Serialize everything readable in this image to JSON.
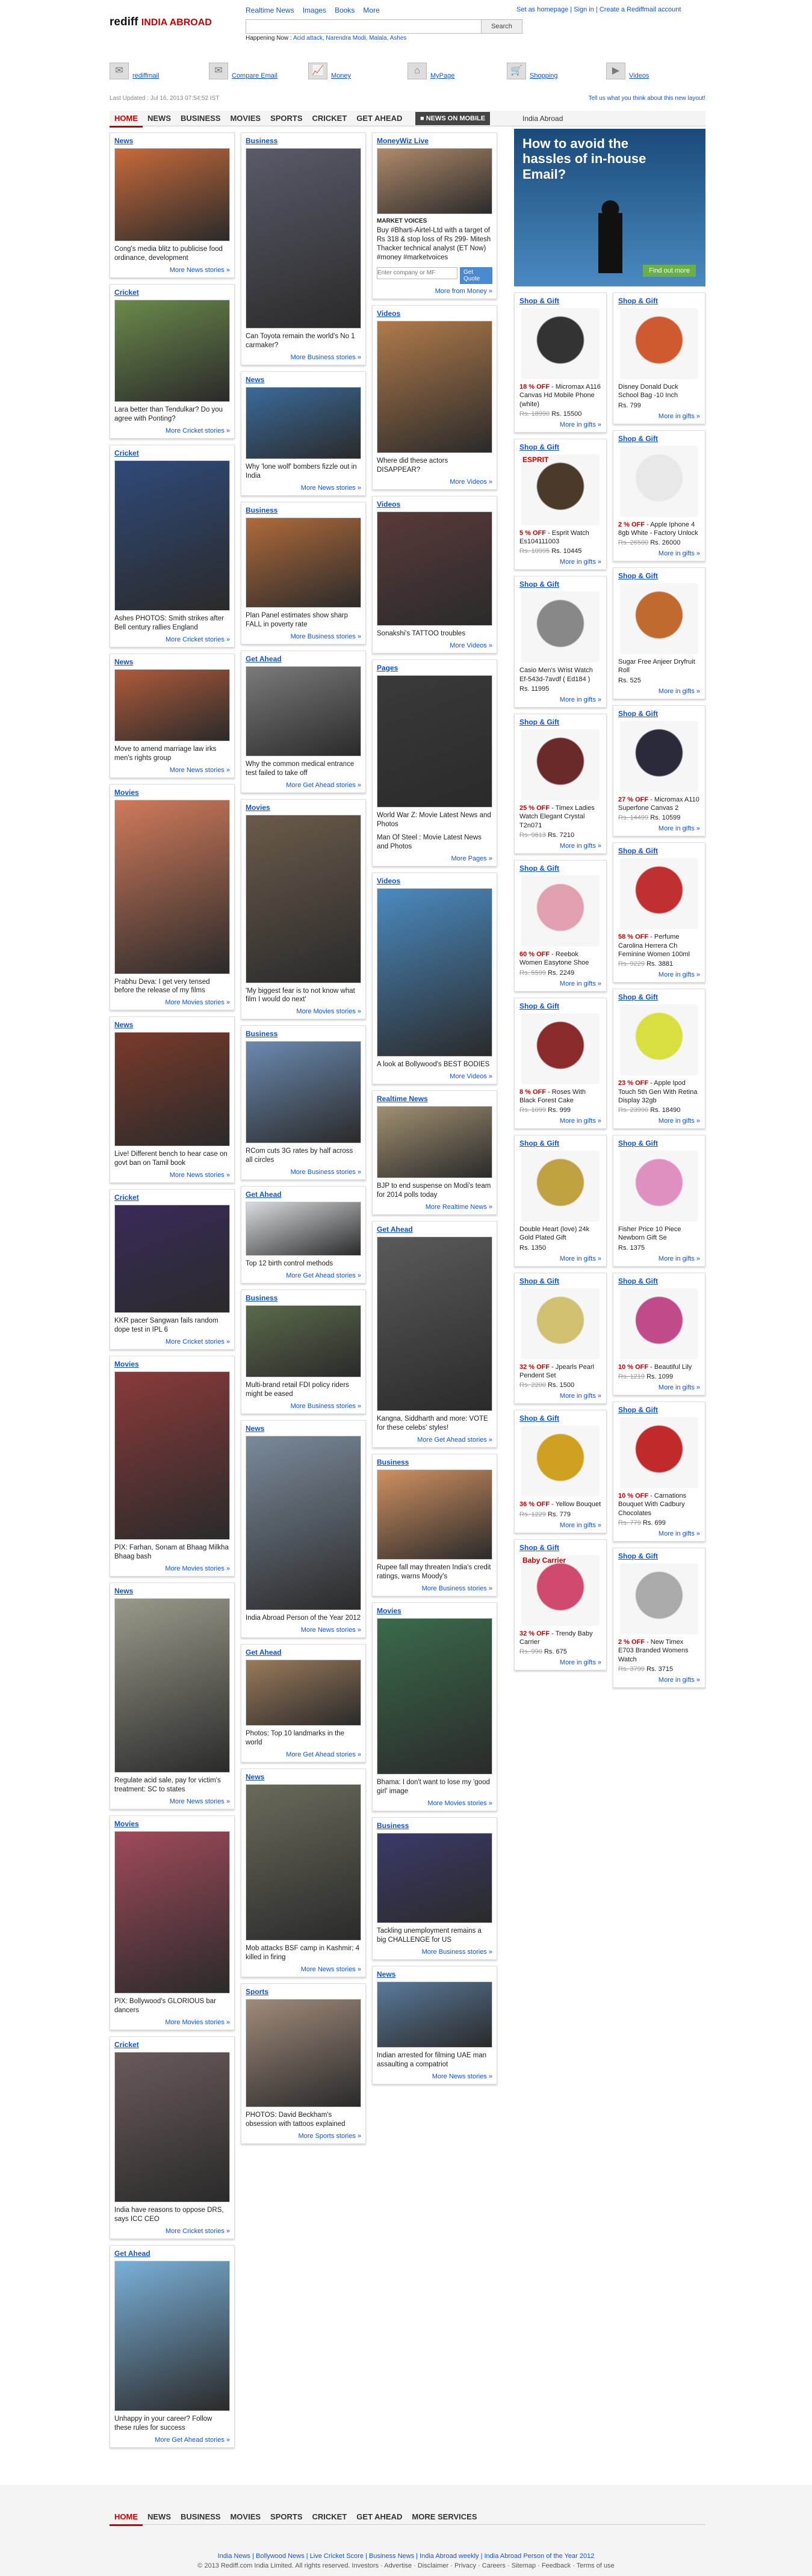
{
  "brand": {
    "rediff": "rediff",
    "section": "INDIA ABROAD"
  },
  "toplinks": [
    "Realtime News",
    "Images",
    "Books",
    "More"
  ],
  "happening": {
    "label": "Happening Now :",
    "links": "Acid attack, Narendra Modi, Malala, Ashes"
  },
  "search": {
    "label": "Search"
  },
  "account": {
    "homepage": "Set as homepage",
    "signin": "Sign in",
    "create": "Create a Rediffmail account"
  },
  "services": [
    "rediffmail",
    "Compare Email",
    "Money",
    "MyPage",
    "Shopping",
    "Videos"
  ],
  "last_updated": "Last Updated : Jul 16, 2013 07:54:52 IST",
  "feedback_link": "Tell us what you think about this new layout!",
  "nav": [
    "HOME",
    "NEWS",
    "BUSINESS",
    "MOVIES",
    "SPORTS",
    "CRICKET",
    "GET AHEAD"
  ],
  "news_mobile": "NEWS ON MOBILE",
  "india_abroad": "India Abroad",
  "ad": {
    "title": "How to avoid the hassles of in-house Email?",
    "cta": "Find out more"
  },
  "col1": [
    {
      "h": "News",
      "cap": "Cong's media blitz to publicise food ordinance, development",
      "more": "More News stories »",
      "c": "#c86a3a",
      "img": 155
    },
    {
      "h": "Cricket",
      "cap": "Lara better than Tendulkar? Do you agree with Ponting?",
      "more": "More Cricket stories »",
      "c": "#6a8a4a",
      "img": 170
    },
    {
      "h": "Cricket",
      "cap": "Ashes PHOTOS: Smith strikes after Bell century rallies England",
      "more": "More Cricket stories »",
      "c": "#2f4a7a",
      "img": 250
    },
    {
      "h": "News",
      "cap": "Move to amend marriage law irks men's rights group",
      "more": "More News stories »",
      "c": "#b05a3a",
      "img": 120
    },
    {
      "h": "Movies",
      "cap": "Prabhu Deva: I get very tensed before the release of my films",
      "more": "More Movies stories »",
      "c": "#d07a5a",
      "img": 290
    },
    {
      "h": "News",
      "cap": "Live! Different bench to hear case on govt ban on Tamil book",
      "more": "More News stories »",
      "c": "#7a3a2a",
      "img": 190
    },
    {
      "h": "Cricket",
      "cap": "KKR pacer Sangwan fails random dope test in IPL 6",
      "more": "More Cricket stories »",
      "c": "#3a2a5a",
      "img": 180
    },
    {
      "h": "Movies",
      "cap": "PIX: Farhan, Sonam at Bhaag Milkha Bhaag bash",
      "more": "More Movies stories »",
      "c": "#8a3a3a",
      "img": 280
    },
    {
      "h": "News",
      "cap": "Regulate acid sale, pay for victim's treatment: SC to states",
      "more": "More News stories »",
      "c": "#9a9a8a",
      "img": 290
    },
    {
      "h": "Movies",
      "cap": "PIX: Bollywood's GLORIOUS bar dancers",
      "more": "More Movies stories »",
      "c": "#a04a5a",
      "img": 270
    },
    {
      "h": "Cricket",
      "cap": "India have reasons to oppose DRS, says ICC CEO",
      "more": "More Cricket stories »",
      "c": "#6a5a5a",
      "img": 250
    },
    {
      "h": "Get Ahead",
      "cap": "Unhappy in your career? Follow these rules for success",
      "more": "More Get Ahead stories »",
      "c": "#7ab0d8",
      "img": 250
    }
  ],
  "col2": [
    {
      "h": "Business",
      "cap": "Can Toyota remain the world's No 1 carmaker?",
      "more": "More Business stories »",
      "c": "#5a5a6a",
      "img": 300
    },
    {
      "h": "News",
      "cap": "Why 'lone wolf' bombers fizzle out in India",
      "more": "More News stories »",
      "c": "#3a6a9a",
      "img": 120
    },
    {
      "h": "Business",
      "cap": "Plan Panel estimates show sharp FALL in poverty rate",
      "more": "More Business stories »",
      "c": "#b06a3a",
      "img": 150
    },
    {
      "h": "Get Ahead",
      "cap": "Why the common medical entrance test failed to take off",
      "more": "More Get Ahead stories »",
      "c": "#7a7a7a",
      "img": 150
    },
    {
      "h": "Movies",
      "cap": "'My biggest fear is to not know what film I would do next'",
      "more": "More Movies stories »",
      "c": "#6a5a4a",
      "img": 280
    },
    {
      "h": "Business",
      "cap": "RCom cuts 3G rates by half across all circles",
      "more": "More Business stories »",
      "c": "#6a8ab0",
      "img": 170
    },
    {
      "h": "Get Ahead",
      "cap": "Top 12 birth control methods",
      "more": "More Get Ahead stories »",
      "c": "#d8dce0",
      "img": 90
    },
    {
      "h": "Business",
      "cap": "Multi-brand retail FDI policy riders might be eased",
      "more": "More Business stories »",
      "c": "#5a6a4a",
      "img": 120
    },
    {
      "h": "News",
      "cap": "India Abroad Person of the Year 2012",
      "more": "More News stories »",
      "c": "#7a8a9a",
      "img": 290
    },
    {
      "h": "Get Ahead",
      "cap": "Photos: Top 10 landmarks in the world",
      "more": "More Get Ahead stories »",
      "c": "#9a7a5a",
      "img": 110
    },
    {
      "h": "News",
      "cap": "Mob attacks BSF camp in Kashmir; 4 killed in firing",
      "more": "More News stories »",
      "c": "#6a6a5a",
      "img": 260
    },
    {
      "h": "Sports",
      "cap": "PHOTOS: David Beckham's obsession with tattoos explained",
      "more": "More Sports stories »",
      "c": "#a08a7a",
      "img": 180
    }
  ],
  "col3": [
    {
      "h": "MoneyWiz Live",
      "type": "money",
      "cap": "Buy #Bharti-Airtel-Ltd with a target of Rs 318 & stop loss of Rs 299- Mitesh Thacker technical analyst (ET Now) #money #marketvoices",
      "mv": "MARKET VOICES",
      "quote": "Get Quote",
      "ph": "Enter company or MF",
      "more": "More from Money »",
      "c": "#b08a6a",
      "img": 110
    },
    {
      "h": "Videos",
      "cap": "Where did these actors DISAPPEAR?",
      "more": "More Videos »",
      "c": "#b07a4a",
      "img": 220
    },
    {
      "h": "Videos",
      "cap": "Sonakshi's TATTOO troubles",
      "more": "More Videos »",
      "c": "#5a3a3a",
      "img": 190
    },
    {
      "h": "Pages",
      "cap": "World War Z: Movie Latest News and Photos",
      "cap2": "Man Of Steel : Movie Latest News and Photos",
      "more": "More Pages »",
      "c": "#3a3a3a",
      "img": 220
    },
    {
      "h": "Videos",
      "cap": "A look at Bollywood's BEST BODIES",
      "more": "More Videos »",
      "c": "#4a8ac0",
      "img": 280
    },
    {
      "h": "Realtime News",
      "cap": "BJP to end suspense on Modi's team for 2014 polls today",
      "more": "More Realtime News »",
      "c": "#a09070",
      "img": 120
    },
    {
      "h": "Get Ahead",
      "cap": "Kangna, Siddharth and more: VOTE for these celebs' styles!",
      "more": "More Get Ahead stories »",
      "c": "#5a5a5a",
      "img": 290
    },
    {
      "h": "Business",
      "cap": "Rupee fall may threaten India's credit ratings, warns Moody's",
      "more": "More Business stories »",
      "c": "#d09060",
      "img": 150
    },
    {
      "h": "Movies",
      "cap": "Bhama: I don't want to lose my 'good girl' image",
      "more": "More Movies stories »",
      "c": "#3a6a4a",
      "img": 260
    },
    {
      "h": "Business",
      "cap": "Tackling unemployment remains a big CHALLENGE for US",
      "more": "More Business stories »",
      "c": "#3a3a6a",
      "img": 150
    },
    {
      "h": "News",
      "cap": "Indian arrested for filming UAE man assaulting a compatriot",
      "more": "More News stories »",
      "c": "#5a7a9a",
      "img": 110
    }
  ],
  "gifts1": [
    {
      "name": "Micromax A116 Canvas Hd Mobile Phone (white)",
      "off": "18 % OFF",
      "old": "Rs. 18990",
      "price": "Rs. 15500",
      "c": "#333"
    },
    {
      "name": "Esprit Watch Es104111003",
      "off": "5 % OFF",
      "old": "Rs. 10995",
      "price": "Rs. 10445",
      "c": "#4a3a2a",
      "logo": "ESPRIT"
    },
    {
      "name": "Casio Men's Wrist Watch Ef-543d-7avdf ( Ed184 )",
      "off": "",
      "old": "",
      "price": "Rs. 11995",
      "c": "#888"
    },
    {
      "name": "Timex Ladies Watch Elegant Crystal T2n071",
      "off": "25 % OFF",
      "old": "Rs. 9613",
      "price": "Rs. 7210",
      "c": "#6a2a2a"
    },
    {
      "name": "Reebok Women Easytone Shoe",
      "off": "60 % OFF",
      "old": "Rs. 5599",
      "price": "Rs. 2249",
      "c": "#e0a0b0"
    },
    {
      "name": "Roses With Black Forest Cake",
      "off": "8 % OFF",
      "old": "Rs. 1099",
      "price": "Rs. 999",
      "c": "#8a2a2a"
    },
    {
      "name": "Double Heart (love) 24k Gold Plated Gift",
      "off": "",
      "old": "",
      "price": "Rs. 1350",
      "c": "#c0a040"
    },
    {
      "name": "Jpearls Pearl Pendent Set",
      "off": "32 % OFF",
      "old": "Rs. 2200",
      "price": "Rs. 1500",
      "c": "#d0c070"
    },
    {
      "name": "Yellow Bouquet",
      "off": "36 % OFF",
      "old": "Rs. 1229",
      "price": "Rs. 779",
      "c": "#d0a020"
    },
    {
      "name": "Trendy Baby Carrier",
      "off": "32 % OFF",
      "old": "Rs. 990",
      "price": "Rs. 675",
      "c": "#d04a70",
      "logo": "Baby Carrier"
    }
  ],
  "gifts2": [
    {
      "name": "Disney Donald Duck School Bag -10 Inch",
      "off": "",
      "old": "",
      "price": "Rs. 799",
      "c": "#d05a30"
    },
    {
      "name": "Apple Iphone 4 8gb White - Factory Unlock",
      "off": "2 % OFF",
      "old": "Rs. 26500",
      "price": "Rs. 26000",
      "c": "#e8e8e8"
    },
    {
      "name": "Sugar Free Anjeer Dryfruit Roll",
      "off": "",
      "old": "",
      "price": "Rs. 525",
      "c": "#c06a30"
    },
    {
      "name": "Micromax A110 Superfone Canvas 2",
      "off": "27 % OFF",
      "old": "Rs. 14499",
      "price": "Rs. 10599",
      "c": "#2a2a3a"
    },
    {
      "name": "Perfume Carolina Herrera Ch Feminine Women 100ml",
      "off": "58 % OFF",
      "old": "Rs. 9229",
      "price": "Rs. 3881",
      "c": "#c03030"
    },
    {
      "name": "Apple Ipod Touch 5th Gen With Retina Display 32gb",
      "off": "23 % OFF",
      "old": "Rs. 23990",
      "price": "Rs. 18490",
      "c": "#d8e040"
    },
    {
      "name": "Fisher Price 10 Piece Newborn Gift Se",
      "off": "",
      "old": "",
      "price": "Rs. 1375",
      "c": "#e090c0"
    },
    {
      "name": "Beautiful Lily",
      "off": "10 % OFF",
      "old": "Rs. 1219",
      "price": "Rs. 1099",
      "c": "#c04a8a"
    },
    {
      "name": "Carnations Bouquet With Cadbury Chocolates",
      "off": "10 % OFF",
      "old": "Rs. 779",
      "price": "Rs. 699",
      "c": "#c02a2a"
    },
    {
      "name": "New Timex E703 Branded Womens Watch",
      "off": "2 % OFF",
      "old": "Rs. 3799",
      "price": "Rs. 3715",
      "c": "#aaa"
    }
  ],
  "gift_head": "Shop & Gift",
  "gift_more": "More in gifts »",
  "bottom_nav": [
    "HOME",
    "NEWS",
    "BUSINESS",
    "MOVIES",
    "SPORTS",
    "CRICKET",
    "GET AHEAD",
    "MORE SERVICES"
  ],
  "footer": {
    "line1": "India News | Bollywood News | Live Cricket Score | Business News | India Abroad weekly | India Abroad Person of the Year 2012",
    "line2": "© 2013 Rediff.com India Limited. All rights reserved. Investors · Advertise · Disclaimer · Privacy · Careers · Sitemap · Feedback · Terms of use"
  }
}
